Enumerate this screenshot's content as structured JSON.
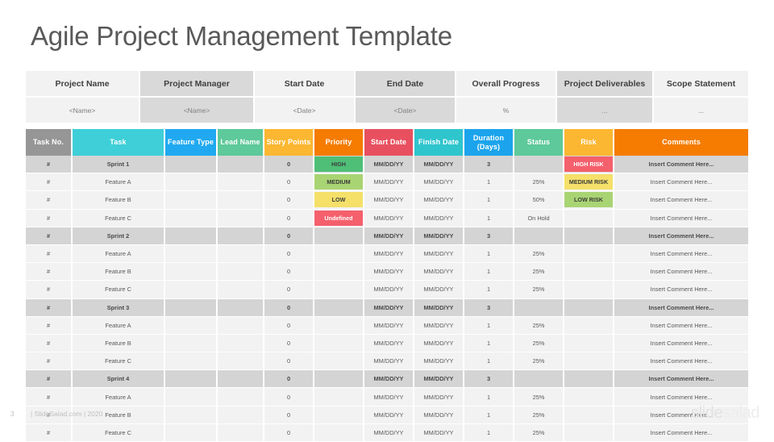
{
  "slide": {
    "title": "Agile Project Management Template",
    "page_number": "3",
    "footer_text": "| SlideSalad.com | 2020",
    "logo_part1": "slide",
    "logo_part2": "salad"
  },
  "info_table": {
    "headers": [
      "Project Name",
      "Project Manager",
      "Start Date",
      "End Date",
      "Overall Progress",
      "Project Deliverables",
      "Scope Statement"
    ],
    "values": [
      "<Name>",
      "<Name>",
      "<Date>",
      "<Date>",
      "%",
      "...",
      "..."
    ]
  },
  "main_table": {
    "headers": [
      {
        "label": "Task No.",
        "color": "#969696"
      },
      {
        "label": "Task",
        "color": "#3ecfd8"
      },
      {
        "label": "Feature Type",
        "color": "#20a9f0"
      },
      {
        "label": "Lead Name",
        "color": "#5ec99a"
      },
      {
        "label": "Story Points",
        "color": "#fbb731"
      },
      {
        "label": "Priority",
        "color": "#f57c00"
      },
      {
        "label": "Start Date",
        "color": "#e8505f"
      },
      {
        "label": "Finish Date",
        "color": "#2fc5cd"
      },
      {
        "label": "Duration (Days)",
        "color": "#1ba4ec"
      },
      {
        "label": "Status",
        "color": "#5ec99a"
      },
      {
        "label": "Risk",
        "color": "#fbb731"
      },
      {
        "label": "Comments",
        "color": "#f57c00"
      }
    ],
    "rows": [
      {
        "type": "sprint",
        "task_no": "#",
        "task": "Sprint 1",
        "feature_type": "",
        "lead_name": "",
        "story_points": "0",
        "priority": "HIGH",
        "priority_class": "bg-high",
        "start_date": "MM/DD/YY",
        "finish_date": "MM/DD/YY",
        "duration": "3",
        "status": "",
        "risk": "HIGH RISK",
        "risk_class": "bg-highrisk",
        "comments": "Insert Comment Here..."
      },
      {
        "type": "feature",
        "task_no": "#",
        "task": "Feature A",
        "feature_type": "",
        "lead_name": "",
        "story_points": "0",
        "priority": "MEDIUM",
        "priority_class": "bg-medium",
        "start_date": "MM/DD/YY",
        "finish_date": "MM/DD/YY",
        "duration": "1",
        "status": "25%",
        "risk": "MEDIUM RISK",
        "risk_class": "bg-medrisk",
        "comments": "Insert Comment Here..."
      },
      {
        "type": "feature",
        "task_no": "#",
        "task": "Feature B",
        "feature_type": "",
        "lead_name": "",
        "story_points": "0",
        "priority": "LOW",
        "priority_class": "bg-low",
        "start_date": "MM/DD/YY",
        "finish_date": "MM/DD/YY",
        "duration": "1",
        "status": "50%",
        "risk": "LOW RISK",
        "risk_class": "bg-lowrisk",
        "comments": "Insert Comment Here..."
      },
      {
        "type": "feature",
        "task_no": "#",
        "task": "Feature C",
        "feature_type": "",
        "lead_name": "",
        "story_points": "0",
        "priority": "Undefined",
        "priority_class": "bg-undefined",
        "start_date": "MM/DD/YY",
        "finish_date": "MM/DD/YY",
        "duration": "1",
        "status": "On Hold",
        "risk": "",
        "risk_class": "",
        "comments": "Insert Comment Here..."
      },
      {
        "type": "sprint",
        "task_no": "#",
        "task": "Sprint 2",
        "feature_type": "",
        "lead_name": "",
        "story_points": "0",
        "priority": "",
        "priority_class": "",
        "start_date": "MM/DD/YY",
        "finish_date": "MM/DD/YY",
        "duration": "3",
        "status": "",
        "risk": "",
        "risk_class": "",
        "comments": "Insert Comment Here..."
      },
      {
        "type": "feature",
        "task_no": "#",
        "task": "Feature A",
        "feature_type": "",
        "lead_name": "",
        "story_points": "0",
        "priority": "",
        "priority_class": "",
        "start_date": "MM/DD/YY",
        "finish_date": "MM/DD/YY",
        "duration": "1",
        "status": "25%",
        "risk": "",
        "risk_class": "",
        "comments": "Insert Comment Here..."
      },
      {
        "type": "feature",
        "task_no": "#",
        "task": "Feature B",
        "feature_type": "",
        "lead_name": "",
        "story_points": "0",
        "priority": "",
        "priority_class": "",
        "start_date": "MM/DD/YY",
        "finish_date": "MM/DD/YY",
        "duration": "1",
        "status": "25%",
        "risk": "",
        "risk_class": "",
        "comments": "Insert Comment Here..."
      },
      {
        "type": "feature",
        "task_no": "#",
        "task": "Feature C",
        "feature_type": "",
        "lead_name": "",
        "story_points": "0",
        "priority": "",
        "priority_class": "",
        "start_date": "MM/DD/YY",
        "finish_date": "MM/DD/YY",
        "duration": "1",
        "status": "25%",
        "risk": "",
        "risk_class": "",
        "comments": "Insert Comment Here..."
      },
      {
        "type": "sprint",
        "task_no": "#",
        "task": "Sprint 3",
        "feature_type": "",
        "lead_name": "",
        "story_points": "0",
        "priority": "",
        "priority_class": "",
        "start_date": "MM/DD/YY",
        "finish_date": "MM/DD/YY",
        "duration": "3",
        "status": "",
        "risk": "",
        "risk_class": "",
        "comments": "Insert Comment Here..."
      },
      {
        "type": "feature",
        "task_no": "#",
        "task": "Feature A",
        "feature_type": "",
        "lead_name": "",
        "story_points": "0",
        "priority": "",
        "priority_class": "",
        "start_date": "MM/DD/YY",
        "finish_date": "MM/DD/YY",
        "duration": "1",
        "status": "25%",
        "risk": "",
        "risk_class": "",
        "comments": "Insert Comment Here..."
      },
      {
        "type": "feature",
        "task_no": "#",
        "task": "Feature B",
        "feature_type": "",
        "lead_name": "",
        "story_points": "0",
        "priority": "",
        "priority_class": "",
        "start_date": "MM/DD/YY",
        "finish_date": "MM/DD/YY",
        "duration": "1",
        "status": "25%",
        "risk": "",
        "risk_class": "",
        "comments": "Insert Comment Here..."
      },
      {
        "type": "feature",
        "task_no": "#",
        "task": "Feature C",
        "feature_type": "",
        "lead_name": "",
        "story_points": "0",
        "priority": "",
        "priority_class": "",
        "start_date": "MM/DD/YY",
        "finish_date": "MM/DD/YY",
        "duration": "1",
        "status": "25%",
        "risk": "",
        "risk_class": "",
        "comments": "Insert Comment Here..."
      },
      {
        "type": "sprint",
        "task_no": "#",
        "task": "Sprint 4",
        "feature_type": "",
        "lead_name": "",
        "story_points": "0",
        "priority": "",
        "priority_class": "",
        "start_date": "MM/DD/YY",
        "finish_date": "MM/DD/YY",
        "duration": "3",
        "status": "",
        "risk": "",
        "risk_class": "",
        "comments": "Insert Comment Here..."
      },
      {
        "type": "feature",
        "task_no": "#",
        "task": "Feature A",
        "feature_type": "",
        "lead_name": "",
        "story_points": "0",
        "priority": "",
        "priority_class": "",
        "start_date": "MM/DD/YY",
        "finish_date": "MM/DD/YY",
        "duration": "1",
        "status": "25%",
        "risk": "",
        "risk_class": "",
        "comments": "Insert Comment Here..."
      },
      {
        "type": "feature",
        "task_no": "#",
        "task": "Feature B",
        "feature_type": "",
        "lead_name": "",
        "story_points": "0",
        "priority": "",
        "priority_class": "",
        "start_date": "MM/DD/YY",
        "finish_date": "MM/DD/YY",
        "duration": "1",
        "status": "25%",
        "risk": "",
        "risk_class": "",
        "comments": "Insert Comment Here..."
      },
      {
        "type": "feature",
        "task_no": "#",
        "task": "Feature C",
        "feature_type": "",
        "lead_name": "",
        "story_points": "0",
        "priority": "",
        "priority_class": "",
        "start_date": "MM/DD/YY",
        "finish_date": "MM/DD/YY",
        "duration": "1",
        "status": "25%",
        "risk": "",
        "risk_class": "",
        "comments": "Insert Comment Here..."
      }
    ]
  }
}
